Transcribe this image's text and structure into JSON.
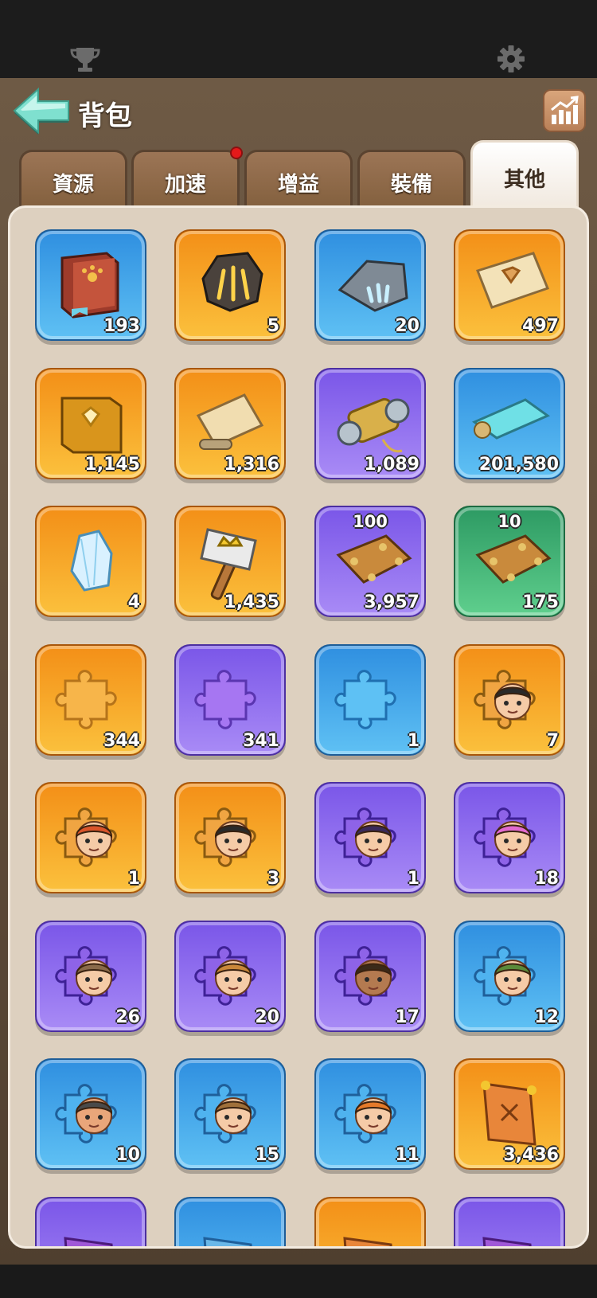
{
  "header": {
    "title": "背包"
  },
  "tabs": [
    {
      "label": "資源",
      "active": false,
      "has_notification": false
    },
    {
      "label": "加速",
      "active": false,
      "has_notification": true
    },
    {
      "label": "增益",
      "active": false,
      "has_notification": false
    },
    {
      "label": "裝備",
      "active": false,
      "has_notification": false
    },
    {
      "label": "其他",
      "active": true,
      "has_notification": false
    }
  ],
  "colors": {
    "blue": "#2f8fe0",
    "orange": "#f38f17",
    "purple": "#7a56e8",
    "green": "#2d9a63",
    "notification": "#e5191a"
  },
  "items": [
    {
      "icon": "paw-book-icon",
      "rarity": "blue",
      "count": "193"
    },
    {
      "icon": "rune-stone-icon",
      "rarity": "orange",
      "count": "5"
    },
    {
      "icon": "claw-stone-icon",
      "rarity": "blue",
      "count": "20"
    },
    {
      "icon": "gem-scroll-icon",
      "rarity": "orange",
      "count": "497"
    },
    {
      "icon": "gem-book-icon",
      "rarity": "orange",
      "count": "1,145"
    },
    {
      "icon": "map-scroll-icon",
      "rarity": "orange",
      "count": "1,316"
    },
    {
      "icon": "thread-spool-icon",
      "rarity": "purple",
      "count": "1,089"
    },
    {
      "icon": "blue-scroll-icon",
      "rarity": "blue",
      "count": "201,580"
    },
    {
      "icon": "crystal-icon",
      "rarity": "orange",
      "count": "4"
    },
    {
      "icon": "crown-hammer-icon",
      "rarity": "orange",
      "count": "1,435"
    },
    {
      "icon": "wood-plank-icon",
      "rarity": "purple",
      "count": "3,957",
      "badge": "100"
    },
    {
      "icon": "wood-plank-icon",
      "rarity": "green",
      "count": "175",
      "badge": "10"
    },
    {
      "icon": "orange-puzzle-icon",
      "rarity": "orange",
      "count": "344"
    },
    {
      "icon": "purple-puzzle-icon",
      "rarity": "purple",
      "count": "341"
    },
    {
      "icon": "blue-puzzle-icon",
      "rarity": "blue",
      "count": "1"
    },
    {
      "icon": "pirate-hero-puzzle-icon",
      "rarity": "orange",
      "count": "7"
    },
    {
      "icon": "redhead-hero-puzzle-icon",
      "rarity": "orange",
      "count": "1"
    },
    {
      "icon": "dark-hair-hero-puzzle-icon",
      "rarity": "orange",
      "count": "3"
    },
    {
      "icon": "witch-hero-puzzle-icon",
      "rarity": "purple",
      "count": "1"
    },
    {
      "icon": "pink-hair-hero-puzzle-icon",
      "rarity": "purple",
      "count": "18"
    },
    {
      "icon": "swordsman-hero-puzzle-icon",
      "rarity": "purple",
      "count": "26"
    },
    {
      "icon": "bearded-hat-hero-puzzle-icon",
      "rarity": "purple",
      "count": "20"
    },
    {
      "icon": "bald-warrior-hero-puzzle-icon",
      "rarity": "purple",
      "count": "17"
    },
    {
      "icon": "archer-hero-puzzle-icon",
      "rarity": "blue",
      "count": "12"
    },
    {
      "icon": "helmet-hero-puzzle-icon",
      "rarity": "blue",
      "count": "10"
    },
    {
      "icon": "goggles-hero-puzzle-icon",
      "rarity": "blue",
      "count": "15"
    },
    {
      "icon": "dwarf-hero-puzzle-icon",
      "rarity": "blue",
      "count": "11"
    },
    {
      "icon": "emblem-book-icon",
      "rarity": "orange",
      "count": "3,436"
    },
    {
      "icon": "purple-emblem-book-icon",
      "rarity": "purple",
      "count": ""
    },
    {
      "icon": "blue-emblem-book-icon",
      "rarity": "blue",
      "count": ""
    },
    {
      "icon": "flag-book-icon",
      "rarity": "orange",
      "count": ""
    },
    {
      "icon": "purple-flag-book-icon",
      "rarity": "purple",
      "count": ""
    }
  ]
}
